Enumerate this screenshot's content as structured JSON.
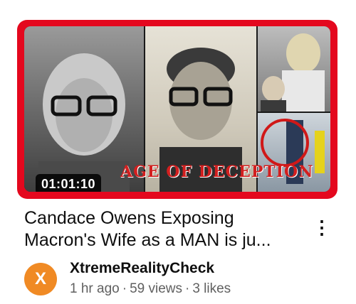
{
  "thumbnail": {
    "duration": "01:01:10",
    "overlay_text": "AGE OF DECEPTION",
    "border_color": "#e4081e"
  },
  "video": {
    "title": "Candace Owens Exposing Macron's Wife as a MAN is ju..."
  },
  "channel": {
    "avatar_letter": "X",
    "avatar_color": "#f08a24",
    "name": "XtremeRealityCheck"
  },
  "meta": {
    "age": "1 hr ago",
    "views": "59 views",
    "likes": "3 likes",
    "separator": "·"
  },
  "menu": {
    "icon": "more-vertical-icon",
    "glyph": "⋮"
  }
}
